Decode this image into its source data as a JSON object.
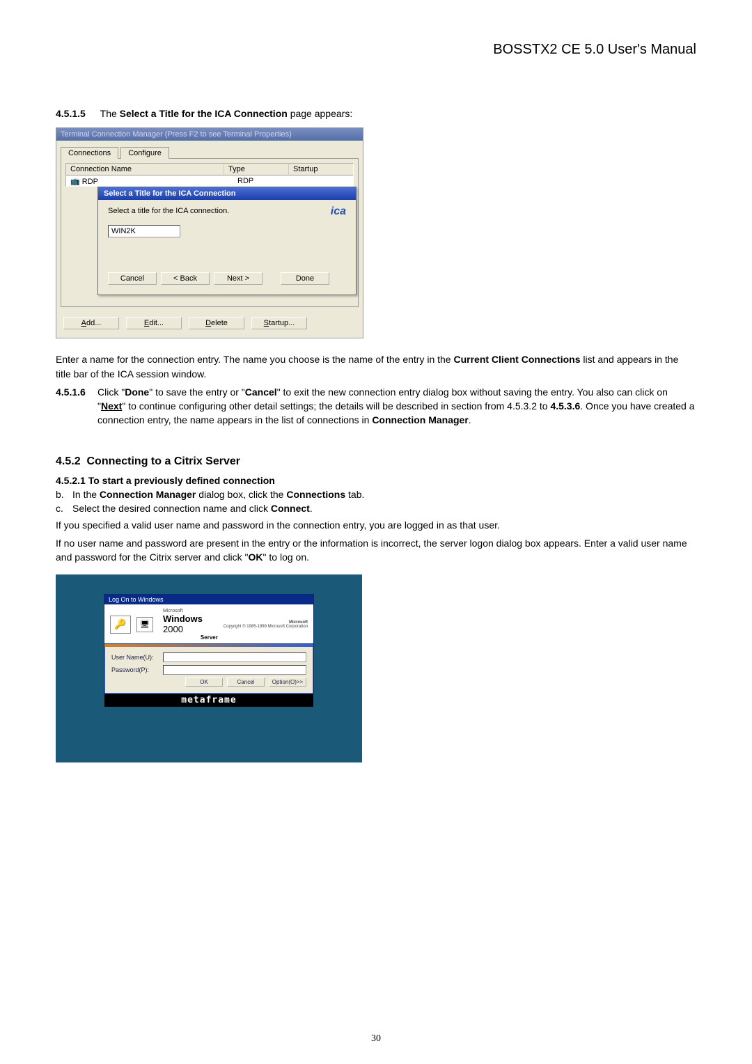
{
  "header": {
    "title": "BOSSTX2 CE 5.0 User's Manual"
  },
  "sec4515": {
    "num": "4.5.1.5",
    "pre": "The ",
    "bold": "Select a Title for the ICA Connection",
    "post": " page appears:"
  },
  "fig1": {
    "window_title": "Terminal Connection Manager  (Press F2 to see Terminal Properties)",
    "tab_connections": "Connections",
    "tab_configure": "Configure",
    "col_name": "Connection Name",
    "col_type": "Type",
    "col_startup": "Startup",
    "row_rdp_name": "RDP",
    "row_rdp_type": "RDP",
    "modal_title": "Select a Title for the ICA Connection",
    "modal_label": "Select a title for the ICA connection.",
    "ica_logo": "ica",
    "input_value": "WIN2K",
    "btn_cancel": "Cancel",
    "btn_back": "< Back",
    "btn_next": "Next >",
    "btn_done": "Done",
    "bottom_add": "Add...",
    "bottom_edit": "Edit...",
    "bottom_delete": "Delete",
    "bottom_startup": "Startup..."
  },
  "para_entername_a": "Enter a name for the connection entry. The name you choose is the name of the entry in the ",
  "para_entername_b": "Current Client Connections",
  "para_entername_c": " list and appears in the title bar of the ICA session window.",
  "sec4516": {
    "num": "4.5.1.6",
    "a": "Click \"",
    "done": "Done",
    "b": "\" to save the entry or \"",
    "cancel": "Cancel",
    "c": "\" to exit the new connection entry dialog box without saving the entry. You also can click on \"",
    "next": "Next",
    "d": "\" to continue configuring other detail settings; the details will be described in section from 4.5.3.2 to ",
    "e4536": "4.5.3.6",
    "e": ". Once you have created a connection entry, the name appears in the list of connections in ",
    "cm": "Connection Manager",
    "period": "."
  },
  "sec452": {
    "num": "4.5.2",
    "title": "Connecting to a Citrix Server"
  },
  "sec4521": {
    "num": "4.5.2.1",
    "title": "To start a previously defined connection"
  },
  "li_b": {
    "marker": "b.",
    "a": "In the ",
    "cm": "Connection Manager",
    "b": " dialog box, click the ",
    "conn": "Connections",
    "c": " tab."
  },
  "li_c": {
    "marker": "c.",
    "a": "Select the desired connection name and click ",
    "connect": "Connect",
    "b": "."
  },
  "para_valid": "If you specified a valid user name and password in the connection entry, you are logged in as that user.",
  "para_nouser_a": "If no user name and password are present in the entry or the information is incorrect, the server logon dialog box appears. Enter a valid user name and password for the Citrix server and click \"",
  "para_nouser_ok": "OK",
  "para_nouser_b": "\" to log on.",
  "fig2": {
    "title": "Log On to Windows",
    "ms_small": "Microsoft",
    "win_label": "Windows",
    "win_year": "2000",
    "server": "Server",
    "copyright": "Copyright © 1985-1999 Microsoft Corporation",
    "microsoft_bold": "Microsoft",
    "username_label": "User Name(U):",
    "password_label": "Password(P):",
    "btn_ok": "OK",
    "btn_cancel": "Cancel",
    "btn_option": "Option(O)>>",
    "metaframe": "metaframe"
  },
  "page_number": "30"
}
